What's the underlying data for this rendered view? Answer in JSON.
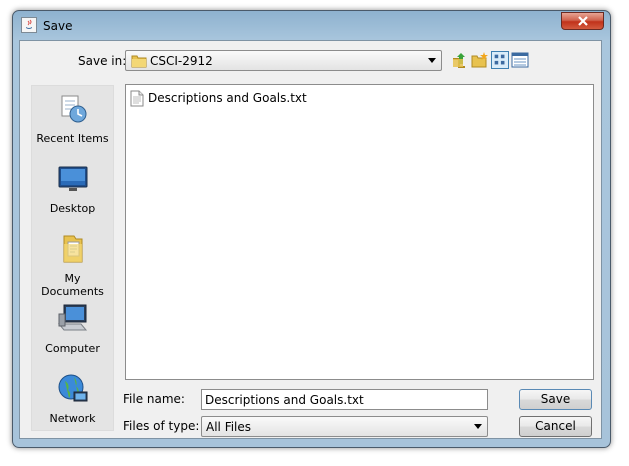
{
  "window": {
    "title": "Save"
  },
  "save_in": {
    "label": "Save in:",
    "value": "CSCI-2912"
  },
  "toolbar": {
    "icons": [
      "up-one-level-icon",
      "create-new-folder-icon",
      "list-view-icon",
      "details-view-icon"
    ]
  },
  "places": [
    {
      "label": "Recent Items",
      "icon": "recent-items-icon"
    },
    {
      "label": "Desktop",
      "icon": "desktop-icon"
    },
    {
      "label": "My Documents",
      "icon": "my-documents-icon"
    },
    {
      "label": "Computer",
      "icon": "computer-icon"
    },
    {
      "label": "Network",
      "icon": "network-icon"
    }
  ],
  "files": [
    {
      "name": "Descriptions and Goals.txt",
      "icon": "text-file-icon"
    }
  ],
  "file_name": {
    "label": "File name:",
    "value": "Descriptions and Goals.txt"
  },
  "file_type": {
    "label": "Files of type:",
    "value": "All Files"
  },
  "buttons": {
    "save": "Save",
    "cancel": "Cancel"
  },
  "colors": {
    "frame": "#a9c6dd",
    "close": "#c1321b",
    "panel": "#f0f0f0"
  }
}
